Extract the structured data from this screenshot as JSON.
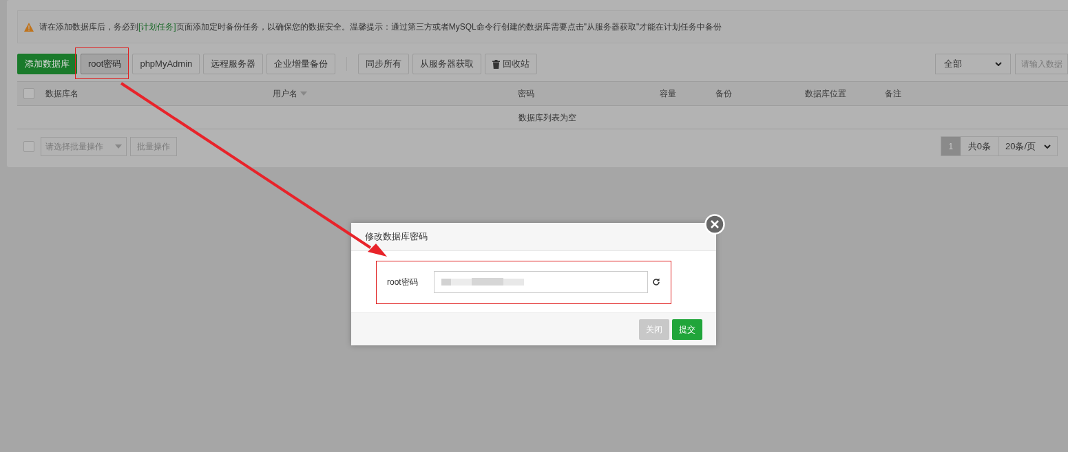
{
  "notice": {
    "before": "请在添加数据库后，务必到",
    "link": "[计划任务]",
    "after": "页面添加定时备份任务，以确保您的数据安全。温馨提示：通过第三方或者MySQL命令行创建的数据库需要点击\"从服务器获取\"才能在计划任务中备份"
  },
  "toolbar": {
    "groups": [
      [
        {
          "label": "添加数据库",
          "kind": "primary"
        },
        {
          "label": "root密码",
          "kind": "pressed"
        },
        {
          "label": "phpMyAdmin",
          "kind": "default"
        },
        {
          "label": "远程服务器",
          "kind": "default"
        },
        {
          "label": "企业增量备份",
          "kind": "default"
        }
      ],
      [
        {
          "label": "同步所有",
          "kind": "default"
        },
        {
          "label": "从服务器获取",
          "kind": "default"
        },
        {
          "label": "回收站",
          "kind": "trash"
        }
      ]
    ],
    "filter": {
      "value": "全部"
    },
    "search": {
      "placeholder": "请输入数据"
    }
  },
  "table": {
    "select_all": {
      "checked": false
    },
    "columns": [
      {
        "label": "数据库名",
        "sortable": false
      },
      {
        "label": "用户名",
        "sortable": true
      },
      {
        "label": "密码",
        "sortable": false
      },
      {
        "label": "容量",
        "sortable": false
      },
      {
        "label": "备份",
        "sortable": false
      },
      {
        "label": "数据库位置",
        "sortable": false
      },
      {
        "label": "备注",
        "sortable": false
      }
    ],
    "empty_text": "数据库列表为空"
  },
  "footer": {
    "select_all": {
      "checked": false
    },
    "batch_placeholder": "请选择批量操作",
    "batch_button": "批量操作",
    "pages": [
      {
        "label": "1",
        "selected": true
      }
    ],
    "total": "共0条",
    "page_size": "20条/页"
  },
  "dialog": {
    "title": "修改数据库密码",
    "field_label": "root密码",
    "buttons": [
      {
        "label": "关闭",
        "kind": "secondary"
      },
      {
        "label": "提交",
        "kind": "primary"
      }
    ]
  }
}
